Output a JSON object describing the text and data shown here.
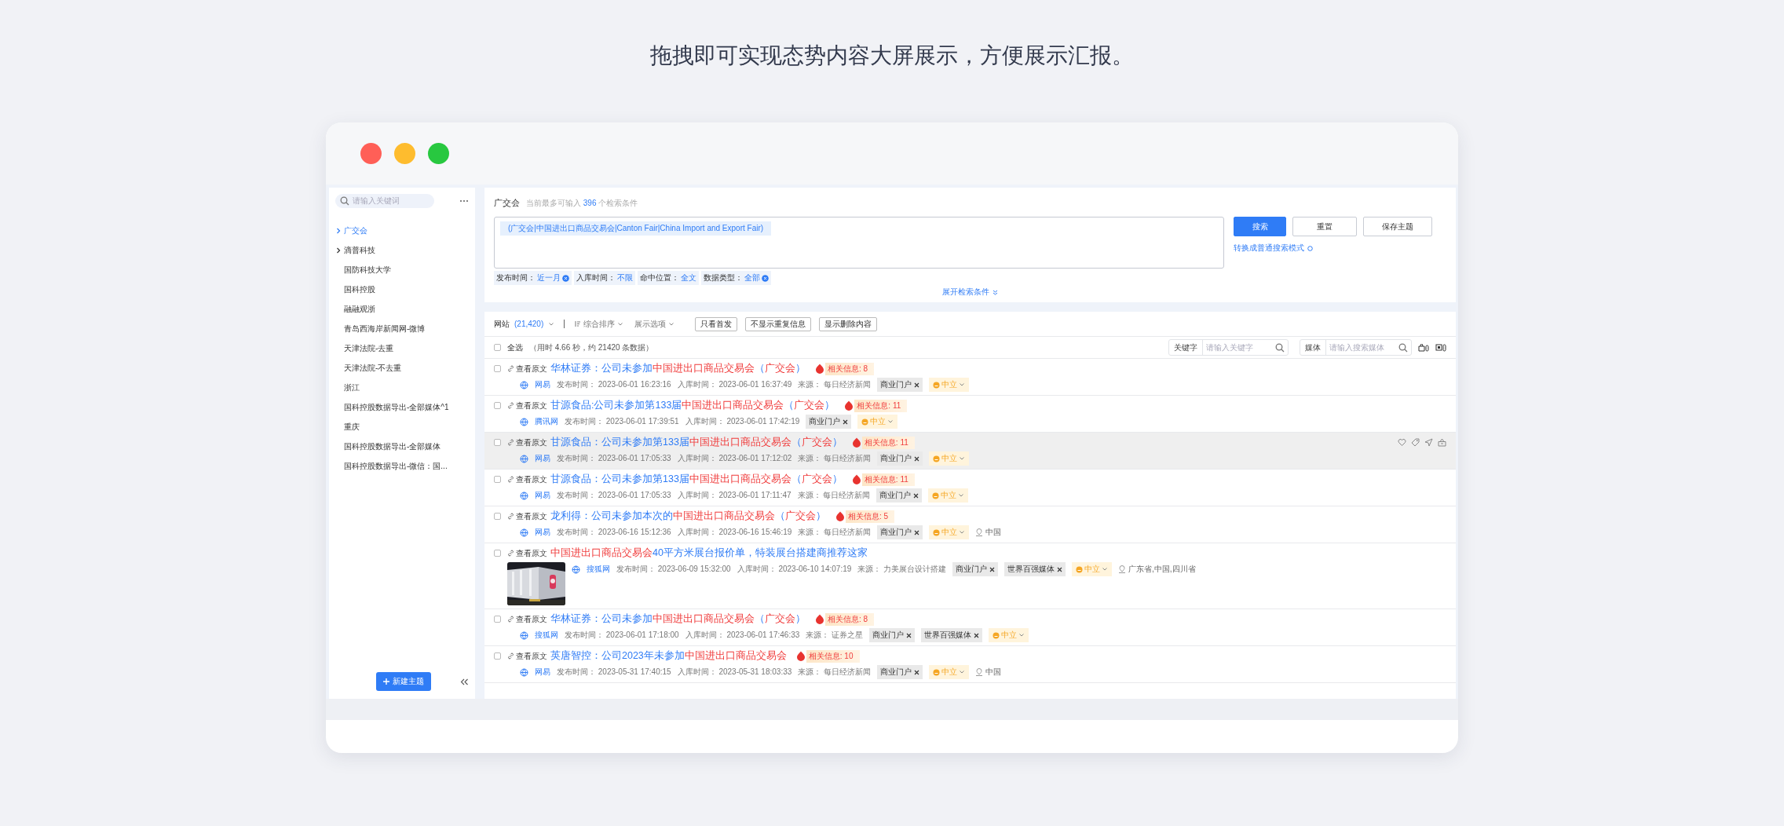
{
  "heading": "拖拽即可实现态势内容大屏展示，方便展示汇报。",
  "window": {
    "controls": [
      {
        "color": "#ff5f57"
      },
      {
        "color": "#febc2e"
      },
      {
        "color": "#28c840"
      }
    ]
  },
  "sidebar": {
    "search": {
      "placeholder": "请输入关键词"
    },
    "items": [
      {
        "label": "广交会",
        "expandable": true,
        "selected": true
      },
      {
        "label": "滴普科技",
        "expandable": true,
        "selected": false
      },
      {
        "label": "国防科技大学",
        "expandable": false,
        "selected": false
      },
      {
        "label": "国科控股",
        "expandable": false,
        "selected": false
      },
      {
        "label": "融融观浙",
        "expandable": false,
        "selected": false
      },
      {
        "label": "青岛西海岸新闻网-微博",
        "expandable": false,
        "selected": false
      },
      {
        "label": "天津法院-去重",
        "expandable": false,
        "selected": false
      },
      {
        "label": "天津法院-不去重",
        "expandable": false,
        "selected": false
      },
      {
        "label": "浙江",
        "expandable": false,
        "selected": false
      },
      {
        "label": "国科控股数据导出-全部媒体^1",
        "expandable": false,
        "selected": false
      },
      {
        "label": "重庆",
        "expandable": false,
        "selected": false
      },
      {
        "label": "国科控股数据导出-全部媒体",
        "expandable": false,
        "selected": false
      },
      {
        "label": "国科控股数据导出-微信：国...",
        "expandable": false,
        "selected": false
      }
    ],
    "new_button": "新建主题"
  },
  "search_panel": {
    "title": "广交会",
    "hint_prefix": "当前最多可输入",
    "hint_count": "396",
    "hint_suffix": "个检索条件",
    "query": "(广交会|中国进出口商品交易会|Canton Fair|China Import and Export Fair)",
    "filters": [
      {
        "label": "发布时间：",
        "value": "近一月",
        "removable": true
      },
      {
        "label": "入库时间：",
        "value": "不限",
        "removable": false
      },
      {
        "label": "命中位置：",
        "value": "全文",
        "removable": false
      },
      {
        "label": "数据类型：",
        "value": "全部",
        "removable": true
      }
    ],
    "buttons": [
      {
        "label": "搜索",
        "primary": true
      },
      {
        "label": "重置",
        "primary": false
      },
      {
        "label": "保存主题",
        "primary": false
      }
    ],
    "mode_link": "转换成普通搜索模式",
    "expand_link": "展开检索条件"
  },
  "toolbar": {
    "source": "网站",
    "count": "(21,420)",
    "sort": "综合排序",
    "display": "展示选项",
    "toggles": [
      "只看首发",
      "不显示重复信息",
      "显示删除内容"
    ],
    "select_all": {
      "label": "全选",
      "checked": false
    },
    "stats": "（用时 4.66 秒，约 21420 条数据）",
    "keyword": {
      "label": "关键字",
      "placeholder": "请输入关键字"
    },
    "media": {
      "label": "媒体",
      "placeholder": "请输入搜索媒体"
    }
  },
  "rows": [
    {
      "checked": false,
      "hovered": false,
      "link": "查看原文",
      "title": [
        {
          "text": "华林证券：公司未参加",
          "hit": false
        },
        {
          "text": "中国进出口商品交易会",
          "hit": true
        },
        {
          "text": "（",
          "hit": false
        },
        {
          "text": "广交会",
          "hit": true
        },
        {
          "text": "）",
          "hit": false
        }
      ],
      "related": "相关信息: 8",
      "site": "网易",
      "meta": [
        {
          "label": "发布时间：",
          "value": "2023-06-01 16:23:16"
        },
        {
          "label": "入库时间：",
          "value": "2023-06-01 16:37:49"
        },
        {
          "label": "来源：",
          "value": "每日经济新闻"
        }
      ],
      "tags": [
        "商业门户"
      ],
      "sentiment": "中立"
    },
    {
      "checked": false,
      "hovered": false,
      "link": "查看原文",
      "title": [
        {
          "text": "甘源食品:公司未参加第133届",
          "hit": false
        },
        {
          "text": "中国进出口商品交易会",
          "hit": true
        },
        {
          "text": "（",
          "hit": false
        },
        {
          "text": "广交会",
          "hit": true
        },
        {
          "text": "）",
          "hit": false
        }
      ],
      "related": "相关信息: 11",
      "site": "腾讯网",
      "meta": [
        {
          "label": "发布时间：",
          "value": "2023-06-01 17:39:51"
        },
        {
          "label": "入库时间：",
          "value": "2023-06-01 17:42:19"
        }
      ],
      "tags": [
        "商业门户"
      ],
      "sentiment": "中立"
    },
    {
      "checked": false,
      "hovered": true,
      "link": "查看原文",
      "title": [
        {
          "text": "甘源食品：公司未参加第133届",
          "hit": false
        },
        {
          "text": "中国进出口商品交易会",
          "hit": true
        },
        {
          "text": "（",
          "hit": false
        },
        {
          "text": "广交会",
          "hit": true
        },
        {
          "text": "）",
          "hit": false
        }
      ],
      "related": "相关信息: 11",
      "site": "网易",
      "meta": [
        {
          "label": "发布时间：",
          "value": "2023-06-01 17:05:33"
        },
        {
          "label": "入库时间：",
          "value": "2023-06-01 17:12:02"
        },
        {
          "label": "来源：",
          "value": "每日经济新闻"
        }
      ],
      "tags": [
        "商业门户"
      ],
      "sentiment": "中立"
    },
    {
      "checked": false,
      "hovered": false,
      "link": "查看原文",
      "title": [
        {
          "text": "甘源食品：公司未参加第133届",
          "hit": false
        },
        {
          "text": "中国进出口商品交易会",
          "hit": true
        },
        {
          "text": "（",
          "hit": false
        },
        {
          "text": "广交会",
          "hit": true
        },
        {
          "text": "）",
          "hit": false
        }
      ],
      "related": "相关信息: 11",
      "site": "网易",
      "meta": [
        {
          "label": "发布时间：",
          "value": "2023-06-01 17:05:33"
        },
        {
          "label": "入库时间：",
          "value": "2023-06-01 17:11:47"
        },
        {
          "label": "来源：",
          "value": "每日经济新闻"
        }
      ],
      "tags": [
        "商业门户"
      ],
      "sentiment": "中立"
    },
    {
      "checked": false,
      "hovered": false,
      "link": "查看原文",
      "title": [
        {
          "text": "龙利得：公司未参加本次的",
          "hit": false
        },
        {
          "text": "中国进出口商品交易会",
          "hit": true
        },
        {
          "text": "（",
          "hit": false
        },
        {
          "text": "广交会",
          "hit": true
        },
        {
          "text": "）",
          "hit": false
        }
      ],
      "related": "相关信息: 5",
      "site": "网易",
      "meta": [
        {
          "label": "发布时间：",
          "value": "2023-06-16 15:12:36"
        },
        {
          "label": "入库时间：",
          "value": "2023-06-16 15:46:19"
        },
        {
          "label": "来源：",
          "value": "每日经济新闻"
        }
      ],
      "tags": [
        "商业门户"
      ],
      "sentiment": "中立",
      "location": "中国"
    },
    {
      "checked": false,
      "hovered": false,
      "link": "查看原文",
      "title": [
        {
          "text": "中国进出口商品交易会",
          "hit": true
        },
        {
          "text": "40平方米展台报价单，特装展台搭建商推荐这家",
          "hit": false
        }
      ],
      "thumbnail": {
        "kind": "picture"
      },
      "site": "搜狐网",
      "meta": [
        {
          "label": "发布时间：",
          "value": "2023-06-09 15:32:00"
        },
        {
          "label": "入库时间：",
          "value": "2023-06-10 14:07:19"
        },
        {
          "label": "来源：",
          "value": "力美展台设计搭建"
        }
      ],
      "tags": [
        "商业门户",
        "世界百强媒体"
      ],
      "sentiment": "中立",
      "location": "广东省,中国,四川省"
    },
    {
      "checked": false,
      "hovered": false,
      "link": "查看原文",
      "title": [
        {
          "text": "华林证券：公司未参加",
          "hit": false
        },
        {
          "text": "中国进出口商品交易会",
          "hit": true
        },
        {
          "text": "（",
          "hit": false
        },
        {
          "text": "广交会",
          "hit": true
        },
        {
          "text": "）",
          "hit": false
        }
      ],
      "related": "相关信息: 8",
      "site": "搜狐网",
      "meta": [
        {
          "label": "发布时间：",
          "value": "2023-06-01 17:18:00"
        },
        {
          "label": "入库时间：",
          "value": "2023-06-01 17:46:33"
        },
        {
          "label": "来源：",
          "value": "证券之星"
        }
      ],
      "tags": [
        "商业门户",
        "世界百强媒体"
      ],
      "sentiment": "中立"
    },
    {
      "checked": false,
      "hovered": false,
      "link": "查看原文",
      "title": [
        {
          "text": "英唐智控：公司2023年未参加",
          "hit": false
        },
        {
          "text": "中国进出口商品交易会",
          "hit": true
        }
      ],
      "related": "相关信息: 10",
      "site": "网易",
      "meta": [
        {
          "label": "发布时间：",
          "value": "2023-05-31 17:40:15"
        },
        {
          "label": "入库时间：",
          "value": "2023-05-31 18:03:33"
        },
        {
          "label": "来源：",
          "value": "每日经济新闻"
        }
      ],
      "tags": [
        "商业门户"
      ],
      "sentiment": "中立",
      "location": "中国"
    }
  ]
}
